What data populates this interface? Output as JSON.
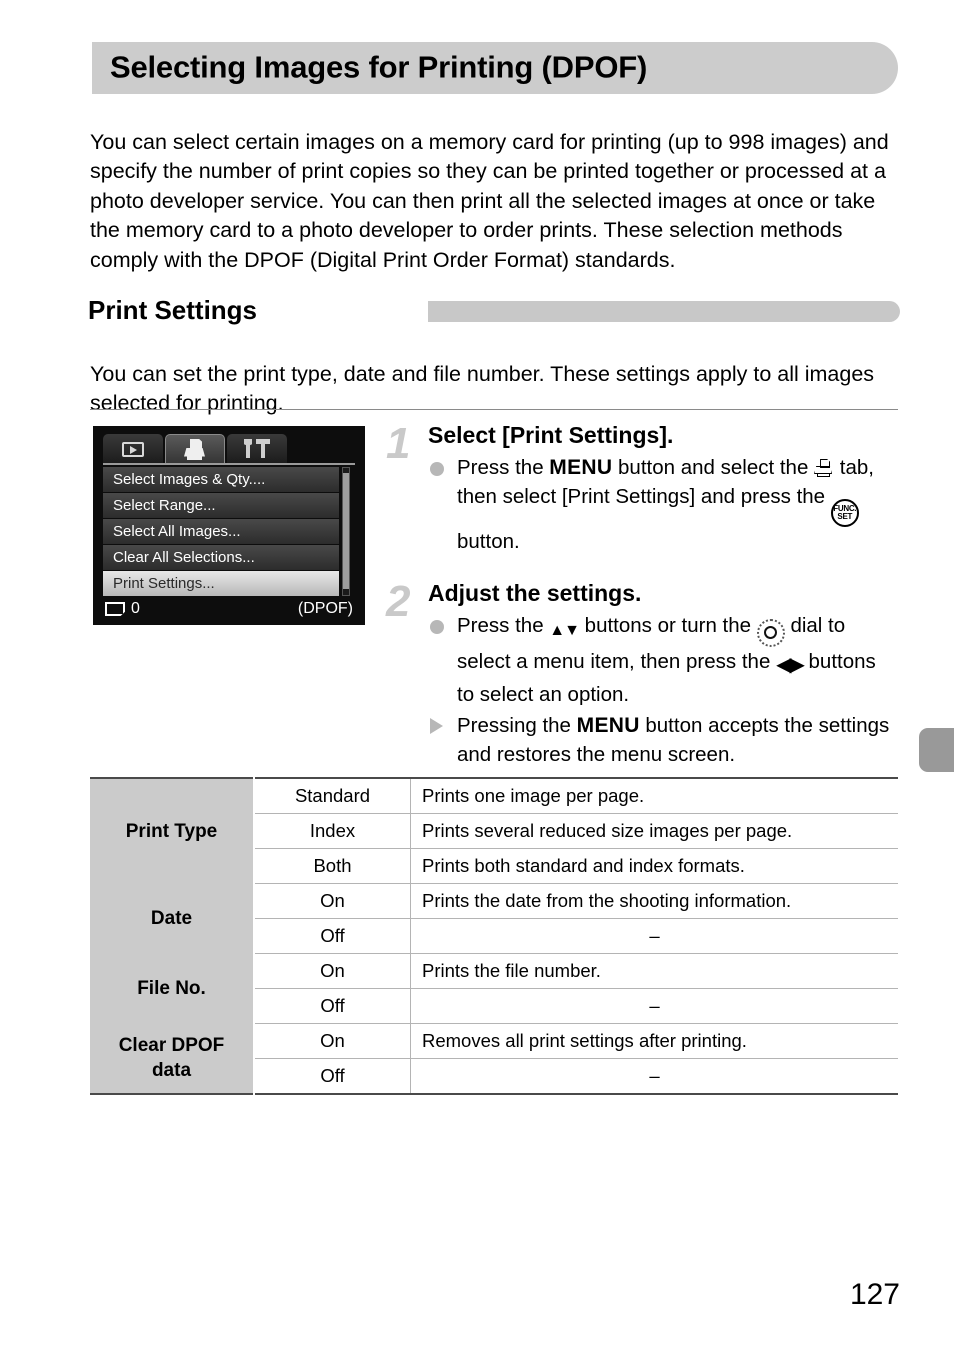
{
  "page": {
    "number": "127",
    "title": "Selecting Images for Printing (DPOF)",
    "intro": "You can select certain images on a memory card for printing (up to 998 images) and specify the number of print copies so they can be printed together or processed at a photo developer service. You can then print all the selected images at once or take the memory card to a photo developer to order prints. These selection methods comply with the DPOF (Digital Print Order Format) standards."
  },
  "section": {
    "heading": "Print Settings",
    "body": "You can set the print type, date and file number. These settings apply to all images selected for printing."
  },
  "lcd": {
    "tabs": [
      {
        "icon": "playback-icon",
        "active": false
      },
      {
        "icon": "print-icon",
        "active": true
      },
      {
        "icon": "tools-icon",
        "active": false
      }
    ],
    "menu_items": [
      "Select Images & Qty....",
      "Select Range...",
      "Select All Images...",
      "Clear All Selections...",
      "Print Settings..."
    ],
    "selected_item": "Print Settings...",
    "status_count": "0",
    "status_right": "(DPOF)"
  },
  "steps": [
    {
      "number": "1",
      "title": "Select [Print Settings].",
      "bullets": [
        {
          "marker": "dot",
          "parts": [
            {
              "t": "text",
              "v": "Press the "
            },
            {
              "t": "menu",
              "v": "MENU"
            },
            {
              "t": "text",
              "v": " button and select the "
            },
            {
              "t": "icon",
              "v": "print-icon"
            },
            {
              "t": "text",
              "v": " tab, then select [Print Settings] and press the "
            },
            {
              "t": "icon",
              "v": "func-set-icon"
            },
            {
              "t": "text",
              "v": " button."
            }
          ]
        }
      ]
    },
    {
      "number": "2",
      "title": "Adjust the settings.",
      "bullets": [
        {
          "marker": "dot",
          "parts": [
            {
              "t": "text",
              "v": "Press the "
            },
            {
              "t": "icon",
              "v": "up-down-arrows-icon"
            },
            {
              "t": "text",
              "v": " buttons or turn the "
            },
            {
              "t": "icon",
              "v": "control-dial-icon"
            },
            {
              "t": "text",
              "v": " dial to select a menu item, then press the "
            },
            {
              "t": "icon",
              "v": "left-right-arrows-icon"
            },
            {
              "t": "text",
              "v": " buttons to select an option."
            }
          ]
        },
        {
          "marker": "triangle",
          "parts": [
            {
              "t": "text",
              "v": "Pressing the "
            },
            {
              "t": "menu",
              "v": "MENU"
            },
            {
              "t": "text",
              "v": " button accepts the settings and restores the menu screen."
            }
          ]
        }
      ]
    }
  ],
  "table": {
    "rows": [
      {
        "category": "Print Type",
        "cat_rowspan": 3,
        "option": "Standard",
        "description": "Prints one image per page."
      },
      {
        "category": null,
        "option": "Index",
        "description": "Prints several reduced size images per page."
      },
      {
        "category": null,
        "option": "Both",
        "description": "Prints both standard and index formats."
      },
      {
        "category": "Date",
        "cat_rowspan": 2,
        "option": "On",
        "description": "Prints the date from the shooting information."
      },
      {
        "category": null,
        "option": "Off",
        "description": "–"
      },
      {
        "category": "File No.",
        "cat_rowspan": 2,
        "option": "On",
        "description": "Prints the file number."
      },
      {
        "category": null,
        "option": "Off",
        "description": "–"
      },
      {
        "category": "Clear DPOF data",
        "cat_rowspan": 2,
        "option": "On",
        "description": "Removes all print settings after printing."
      },
      {
        "category": null,
        "option": "Off",
        "description": "–"
      }
    ]
  },
  "colors": {
    "banner_gray": "#cccccc",
    "section_bar_gray": "#c8c8c8",
    "edge_tab_gray": "#999999",
    "table_header_gray": "#cbcbcb",
    "step_number_gray": "#c9c9c9",
    "bullet_gray": "#b7b7b7"
  }
}
